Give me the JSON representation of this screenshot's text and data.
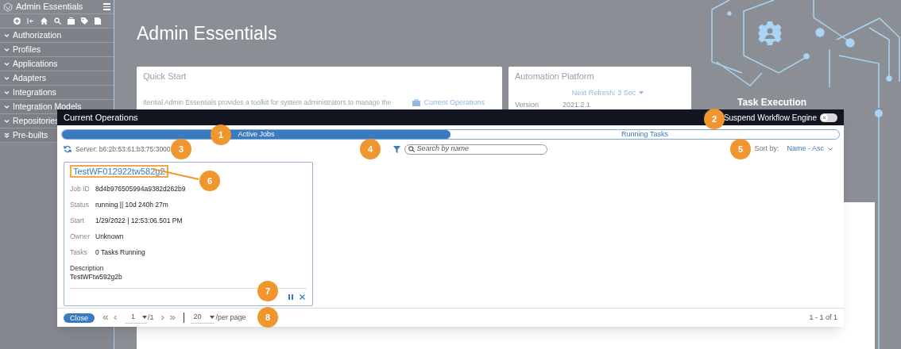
{
  "sidebar": {
    "title": "Admin Essentials",
    "items": [
      {
        "label": "Authorization",
        "kind": "single"
      },
      {
        "label": "Profiles",
        "kind": "single"
      },
      {
        "label": "Applications",
        "kind": "single"
      },
      {
        "label": "Adapters",
        "kind": "single"
      },
      {
        "label": "Integrations",
        "kind": "single"
      },
      {
        "label": "Integration Models",
        "kind": "single"
      },
      {
        "label": "Repositories",
        "kind": "single"
      },
      {
        "label": "Pre-builts",
        "kind": "double"
      }
    ]
  },
  "heading": "Admin Essentials",
  "quick_start": {
    "title": "Quick Start",
    "text": "Itential Admin Essentials provides a toolkit for system administrators to manage the",
    "link": "Current Operations"
  },
  "automation_platform": {
    "title": "Automation Platform",
    "refresh": "Next Refresh: 3 Sec",
    "version_label": "Version",
    "version": "2021.2.1"
  },
  "task_execution": {
    "title": "Task Execution"
  },
  "modal": {
    "title": "Current Operations",
    "suspend_label": "Suspend Workflow Engine",
    "suspend_on": false,
    "tabs": [
      {
        "label": "Active Jobs",
        "selected": true
      },
      {
        "label": "Running Tasks",
        "selected": false
      }
    ],
    "server": "Server: b6:2b:53:61:b3:75:3000",
    "search_placeholder": "Search by name",
    "sort_label": "Sort by:",
    "sort_value": "Name - Asc",
    "jobs": [
      {
        "name": "TestWF012922tw582g2",
        "fields": [
          {
            "label": "Job ID",
            "value": "8d4b976505994a9382d262b9"
          },
          {
            "label": "Status",
            "value": "running || 10d 240h 27m"
          },
          {
            "label": "Start",
            "value": "1/29/2022 | 12:53:06.501 PM"
          },
          {
            "label": "Owner",
            "value": "Unknown"
          },
          {
            "label": "Tasks",
            "value": "0 Tasks Running"
          }
        ],
        "description_label": "Description",
        "description": "TestWFtw592g2b"
      }
    ],
    "close": "Close",
    "page": "1",
    "page_total": "/1",
    "per_page": "20",
    "per_page_label": "/per page",
    "range": "1 - 1 of 1"
  },
  "callouts": [
    "1",
    "2",
    "3",
    "4",
    "5",
    "6",
    "7",
    "8"
  ]
}
